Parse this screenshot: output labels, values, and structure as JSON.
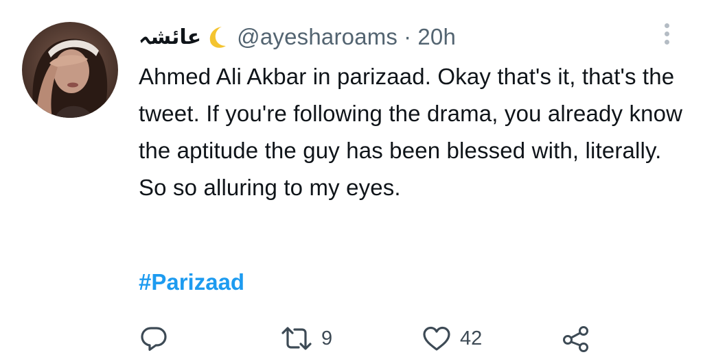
{
  "tweet": {
    "display_name": "عائشہ",
    "handle": "@ayesharoams",
    "separator": "·",
    "time": "20h",
    "text": "Ahmed Ali Akbar in parizaad. Okay that's it, that's the tweet. If you're following the drama, you already know the aptitude the guy has been blessed with, literally. So so alluring to my eyes.",
    "hashtag": "#Parizaad"
  },
  "actions": {
    "reply_count": "",
    "retweet_count": "9",
    "like_count": "42"
  },
  "icons": {
    "name_emoji": "crescent-moon-icon",
    "reply": "reply-icon",
    "retweet": "retweet-icon",
    "like": "heart-icon",
    "share": "share-icon",
    "more": "more-vertical-icon"
  },
  "colors": {
    "text": "#0f1419",
    "secondary": "#536471",
    "link": "#1d9bf0",
    "moon": "#f4c430"
  }
}
